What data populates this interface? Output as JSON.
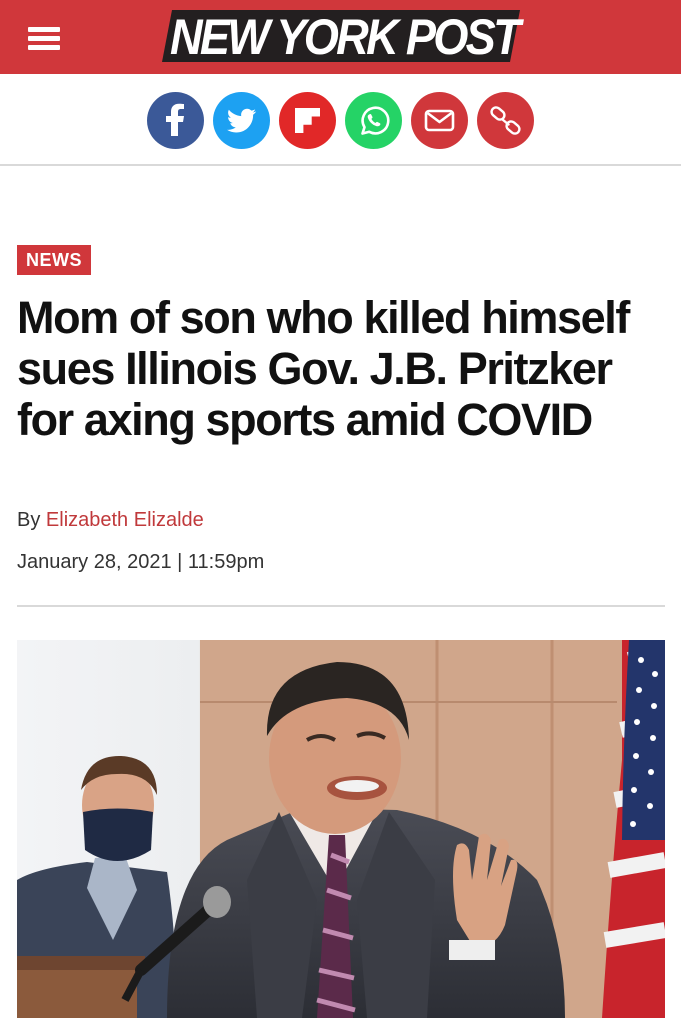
{
  "header": {
    "menu_icon": "hamburger-menu-icon",
    "logo_text": "NEW YORK POST",
    "brand_color": "#d0373b"
  },
  "share": [
    {
      "name": "facebook",
      "icon": "facebook-icon",
      "color": "#3b5998"
    },
    {
      "name": "twitter",
      "icon": "twitter-icon",
      "color": "#1da1f2"
    },
    {
      "name": "flipboard",
      "icon": "flipboard-icon",
      "color": "#e12828"
    },
    {
      "name": "whatsapp",
      "icon": "whatsapp-icon",
      "color": "#25d366"
    },
    {
      "name": "email",
      "icon": "email-icon",
      "color": "#d0373b"
    },
    {
      "name": "copy-link",
      "icon": "link-icon",
      "color": "#d0373b"
    }
  ],
  "article": {
    "section": "NEWS",
    "headline": "Mom of son who killed himself sues Illinois Gov. J.B. Pritzker for axing sports amid COVID",
    "byline_prefix": "By ",
    "author": "Elizabeth Elizalde",
    "date": "January 28, 2021",
    "separator": " | ",
    "time": "11:59pm"
  }
}
